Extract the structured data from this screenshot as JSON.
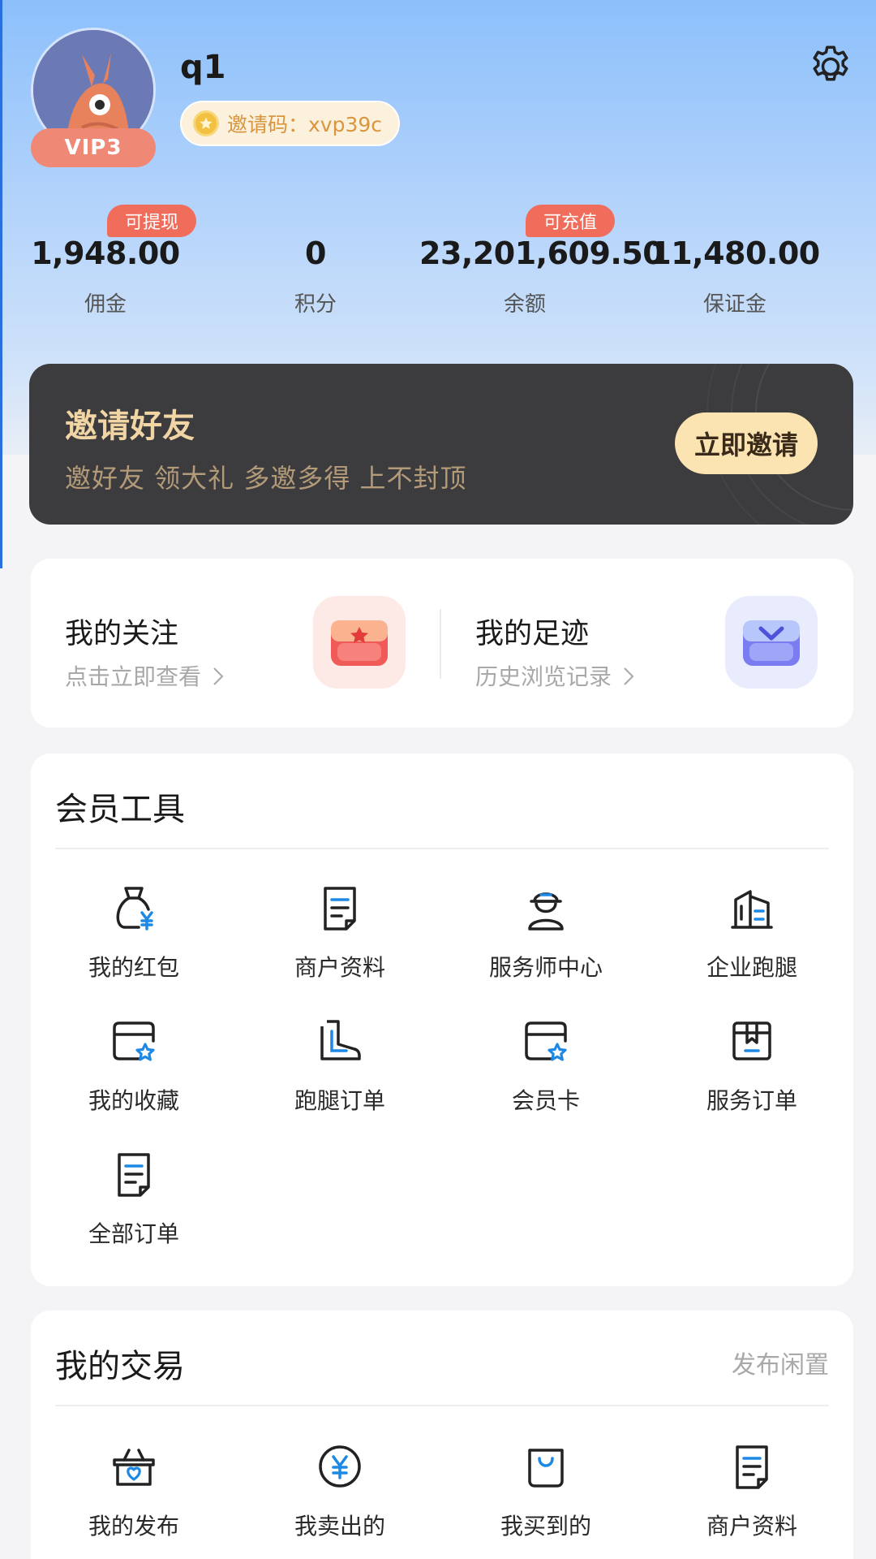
{
  "profile": {
    "username": "q1",
    "vip_level": "VIP3",
    "invite_code_label": "邀请码：xvp39c"
  },
  "stats": [
    {
      "value": "1,948.00",
      "label": "佣金",
      "tag": "可提现"
    },
    {
      "value": "0",
      "label": "积分",
      "tag": ""
    },
    {
      "value": "23,201,609.50",
      "label": "余额",
      "tag": "可充值"
    },
    {
      "value": "11,480.00",
      "label": "保证金",
      "tag": ""
    }
  ],
  "banner": {
    "title": "邀请好友",
    "subtitle": "邀好友 领大礼 多邀多得 上不封顶",
    "button_label": "立即邀请"
  },
  "follow": {
    "items": [
      {
        "title": "我的关注",
        "subtitle": "点击立即查看",
        "icon": "gift-box-icon"
      },
      {
        "title": "我的足迹",
        "subtitle": "历史浏览记录",
        "icon": "footprint-box-icon"
      }
    ]
  },
  "tools": {
    "title": "会员工具",
    "items": [
      {
        "label": "我的红包",
        "icon": "money-bag-icon"
      },
      {
        "label": "商户资料",
        "icon": "document-icon"
      },
      {
        "label": "服务师中心",
        "icon": "worker-icon"
      },
      {
        "label": "企业跑腿",
        "icon": "building-icon"
      },
      {
        "label": "我的收藏",
        "icon": "favorite-card-icon"
      },
      {
        "label": "跑腿订单",
        "icon": "boot-icon"
      },
      {
        "label": "会员卡",
        "icon": "member-card-icon"
      },
      {
        "label": "服务订单",
        "icon": "package-icon"
      },
      {
        "label": "全部订单",
        "icon": "order-list-icon"
      }
    ]
  },
  "trade": {
    "title": "我的交易",
    "link_label": "发布闲置",
    "items": [
      {
        "label": "我的发布",
        "icon": "basket-heart-icon"
      },
      {
        "label": "我卖出的",
        "icon": "yen-circle-icon"
      },
      {
        "label": "我买到的",
        "icon": "shopping-bag-icon"
      },
      {
        "label": "商户资料",
        "icon": "document-icon"
      }
    ]
  },
  "colors": {
    "accent_blue": "#1e88e5",
    "tag_red": "#ef6d5a",
    "banner_dark": "#3c3c3e",
    "banner_gold": "#f2d5a4"
  }
}
